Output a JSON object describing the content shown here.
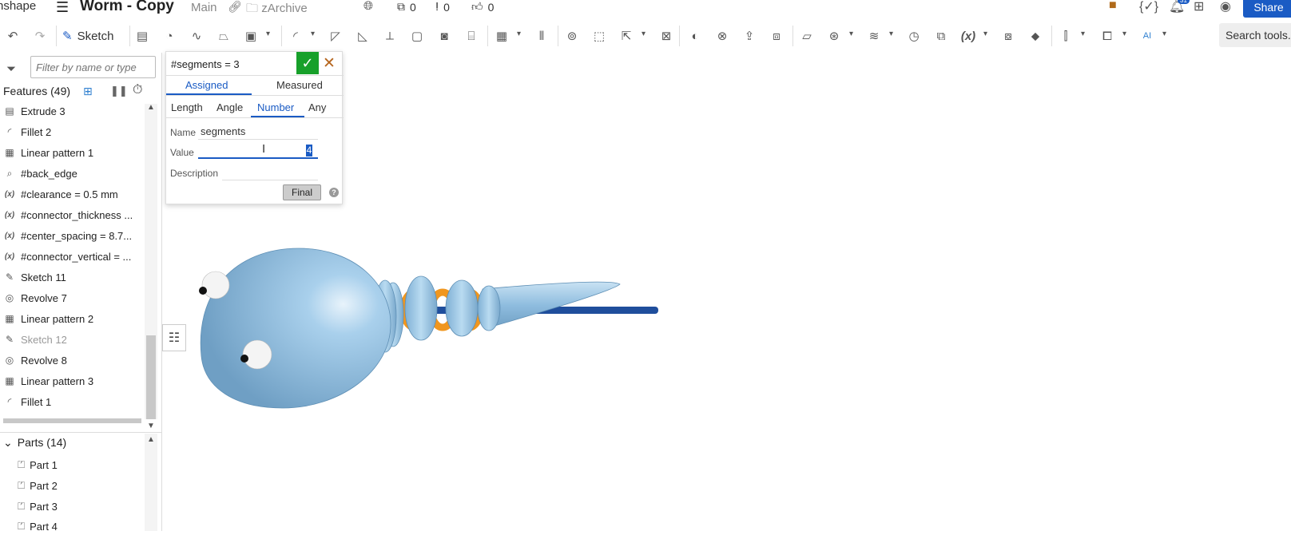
{
  "header": {
    "logo_text": "nshape",
    "doc_title": "Worm - Copy",
    "branch": "Main",
    "folder": "zArchive",
    "versions_count": "0",
    "comments_count": "0",
    "likes_count": "0",
    "notifications_badge": "31",
    "share_label": "Share"
  },
  "toolbar": {
    "sketch_label": "Sketch",
    "search_label": "Search tools..."
  },
  "left_panel": {
    "filter_placeholder": "Filter by name or type",
    "features_header": "Features (49)",
    "features": [
      {
        "label": "Extrude 3",
        "icon": "extrude-icon",
        "glyph": "▤"
      },
      {
        "label": "Fillet 2",
        "icon": "fillet-icon",
        "glyph": "◜"
      },
      {
        "label": "Linear pattern 1",
        "icon": "pattern-icon",
        "glyph": "▦"
      },
      {
        "label": "#back_edge",
        "icon": "query-icon",
        "glyph": "⌕"
      },
      {
        "label": "#clearance = 0.5 mm",
        "icon": "variable-icon",
        "glyph": "(x)"
      },
      {
        "label": "#connector_thickness ...",
        "icon": "variable-icon",
        "glyph": "(x)"
      },
      {
        "label": "#center_spacing = 8.7...",
        "icon": "variable-icon",
        "glyph": "(x)"
      },
      {
        "label": "#connector_vertical = ...",
        "icon": "variable-icon",
        "glyph": "(x)"
      },
      {
        "label": "Sketch 11",
        "icon": "sketch-icon",
        "glyph": "✎"
      },
      {
        "label": "Revolve 7",
        "icon": "revolve-icon",
        "glyph": "◎"
      },
      {
        "label": "Linear pattern 2",
        "icon": "pattern-icon",
        "glyph": "▦"
      },
      {
        "label": "Sketch 12",
        "icon": "sketch-icon",
        "glyph": "✎",
        "muted": true
      },
      {
        "label": "Revolve 8",
        "icon": "revolve-icon",
        "glyph": "◎"
      },
      {
        "label": "Linear pattern 3",
        "icon": "pattern-icon",
        "glyph": "▦"
      },
      {
        "label": "Fillet 1",
        "icon": "fillet-icon",
        "glyph": "◜"
      }
    ],
    "parts_header": "Parts (14)",
    "parts": [
      "Part 1",
      "Part 2",
      "Part 3",
      "Part 4"
    ]
  },
  "variable_dialog": {
    "title": "#segments = 3",
    "tab_assigned": "Assigned",
    "tab_measured": "Measured",
    "sub_length": "Length",
    "sub_angle": "Angle",
    "sub_number": "Number",
    "sub_any": "Any",
    "name_label": "Name",
    "name_value": "segments",
    "value_label": "Value",
    "value_value": "4",
    "description_label": "Description",
    "description_value": "",
    "final_label": "Final",
    "help_glyph": "?"
  },
  "colors": {
    "accent": "#1a5bc4",
    "confirm": "#17a02a",
    "body_blue": "#8fbddf",
    "connector_orange": "#f0961e",
    "rod_blue": "#1f4e9c"
  }
}
